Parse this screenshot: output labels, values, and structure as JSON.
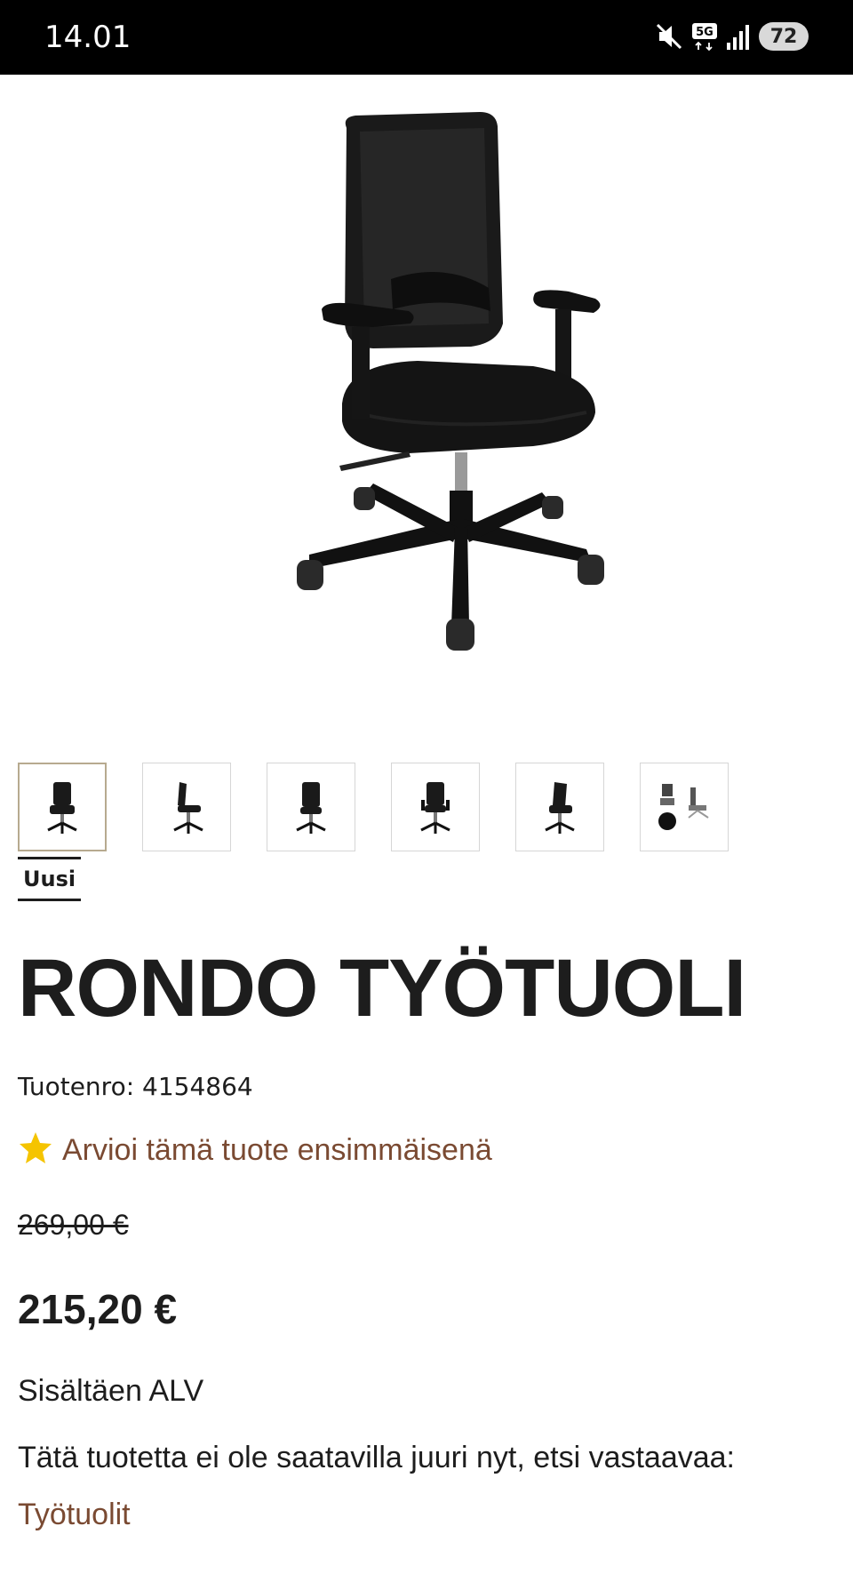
{
  "status_bar": {
    "time": "14.01",
    "network": "5G",
    "battery": "72",
    "icons": [
      "mute-icon",
      "5g-icon",
      "signal-icon",
      "battery-icon"
    ]
  },
  "product": {
    "badge": "Uusi",
    "title": "RONDO TYÖTUOLI",
    "sku_label": "Tuotenro:",
    "sku_value": "4154864",
    "rating_icon": "star-icon",
    "rating_link": "Arvioi tämä tuote ensimmäisenä",
    "old_price": "269,00 €",
    "price": "215,20 €",
    "vat_note": "Sisältäen ALV",
    "availability_text": "Tätä tuotetta ei ole saatavilla juuri nyt, etsi vastaavaa:",
    "availability_link": "Työtuolit",
    "thumbnail_count": 6
  },
  "colors": {
    "text": "#1d1d1d",
    "link": "#7a4a32",
    "star": "#f5c400",
    "active_thumb_border": "#b7aa8f"
  }
}
